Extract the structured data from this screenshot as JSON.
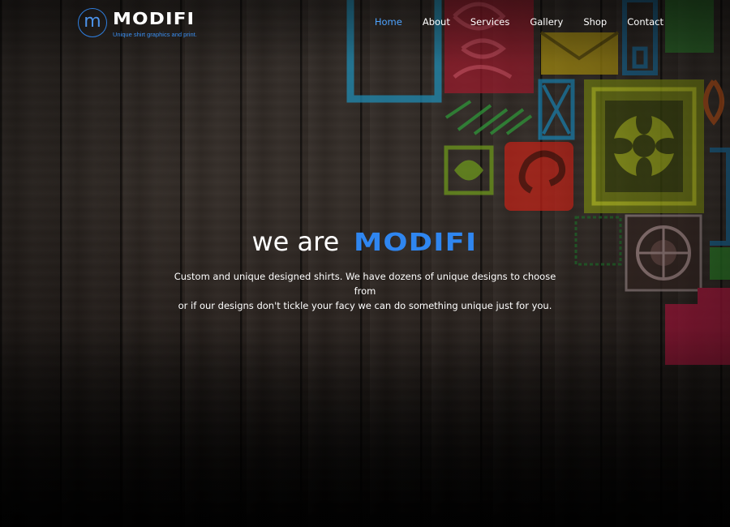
{
  "logo": {
    "mark": "m",
    "wordmark": "MODIFI",
    "tagline": "Unique shirt graphics and print."
  },
  "nav": {
    "items": [
      {
        "label": "Home",
        "active": true
      },
      {
        "label": "About",
        "active": false
      },
      {
        "label": "Services",
        "active": false
      },
      {
        "label": "Gallery",
        "active": false
      },
      {
        "label": "Shop",
        "active": false
      },
      {
        "label": "Contact",
        "active": false
      }
    ]
  },
  "hero": {
    "title_prefix": "we are",
    "title_brand": "MODIFI",
    "text_line1": "Custom and unique designed shirts. We have dozens of unique designs to choose from",
    "text_line2": "or if our designs don't tickle your facy we can do something unique just for you."
  },
  "colors": {
    "accent": "#2f86f0",
    "nav_active": "#4da3ff",
    "text": "#ffffff",
    "background": "#2e2824"
  },
  "icons": [
    "logo-circle-m-icon"
  ]
}
